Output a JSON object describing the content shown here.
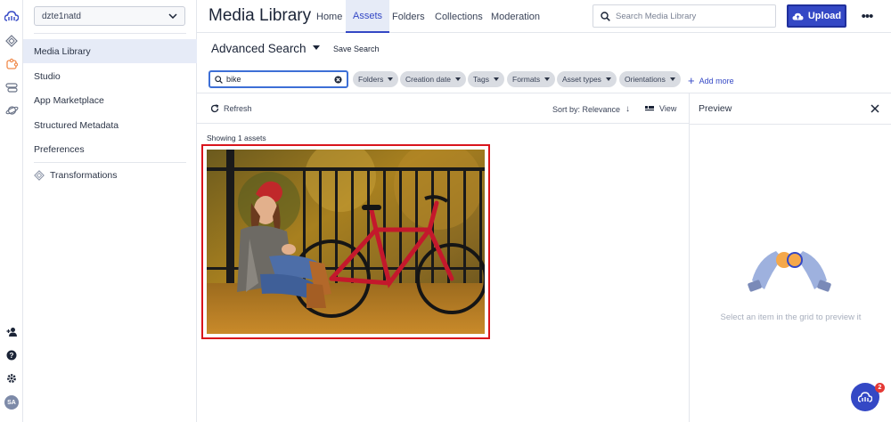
{
  "env_select": {
    "value": "dzte1natd"
  },
  "nav": {
    "items": [
      {
        "label": "Media Library",
        "active": true
      },
      {
        "label": "Studio"
      },
      {
        "label": "App Marketplace"
      },
      {
        "label": "Structured Metadata"
      },
      {
        "label": "Preferences"
      },
      {
        "label": "Transformations"
      }
    ]
  },
  "header": {
    "title": "Media Library",
    "tabs": [
      "Home",
      "Assets",
      "Folders",
      "Collections",
      "Moderation"
    ],
    "active_tab": "Assets",
    "search_placeholder": "Search Media Library",
    "upload_label": "Upload",
    "more_label": "•••"
  },
  "advanced_search": {
    "title": "Advanced Search",
    "save_label": "Save Search",
    "query": "bike",
    "filters": [
      "Folders",
      "Creation date",
      "Tags",
      "Formats",
      "Asset types",
      "Orientations"
    ],
    "add_more_label": "Add more"
  },
  "toolbar": {
    "refresh_label": "Refresh",
    "sort_label": "Sort by: Relevance",
    "view_label": "View"
  },
  "results": {
    "count_text": "Showing 1 assets"
  },
  "preview": {
    "title": "Preview",
    "empty_message": "Select an item in the grid to preview it"
  },
  "user": {
    "initials": "SA"
  },
  "help": {
    "badge_count": "2"
  },
  "colors": {
    "accent": "#3448c5",
    "selection_border": "#d9141c",
    "badge": "#e53935"
  },
  "icons": {
    "rail": [
      "cloudinary-logo-icon",
      "diamond-icon",
      "puzzle-icon",
      "stack-icon",
      "planet-icon",
      "add-user-icon",
      "help-icon",
      "settings-icon"
    ]
  }
}
